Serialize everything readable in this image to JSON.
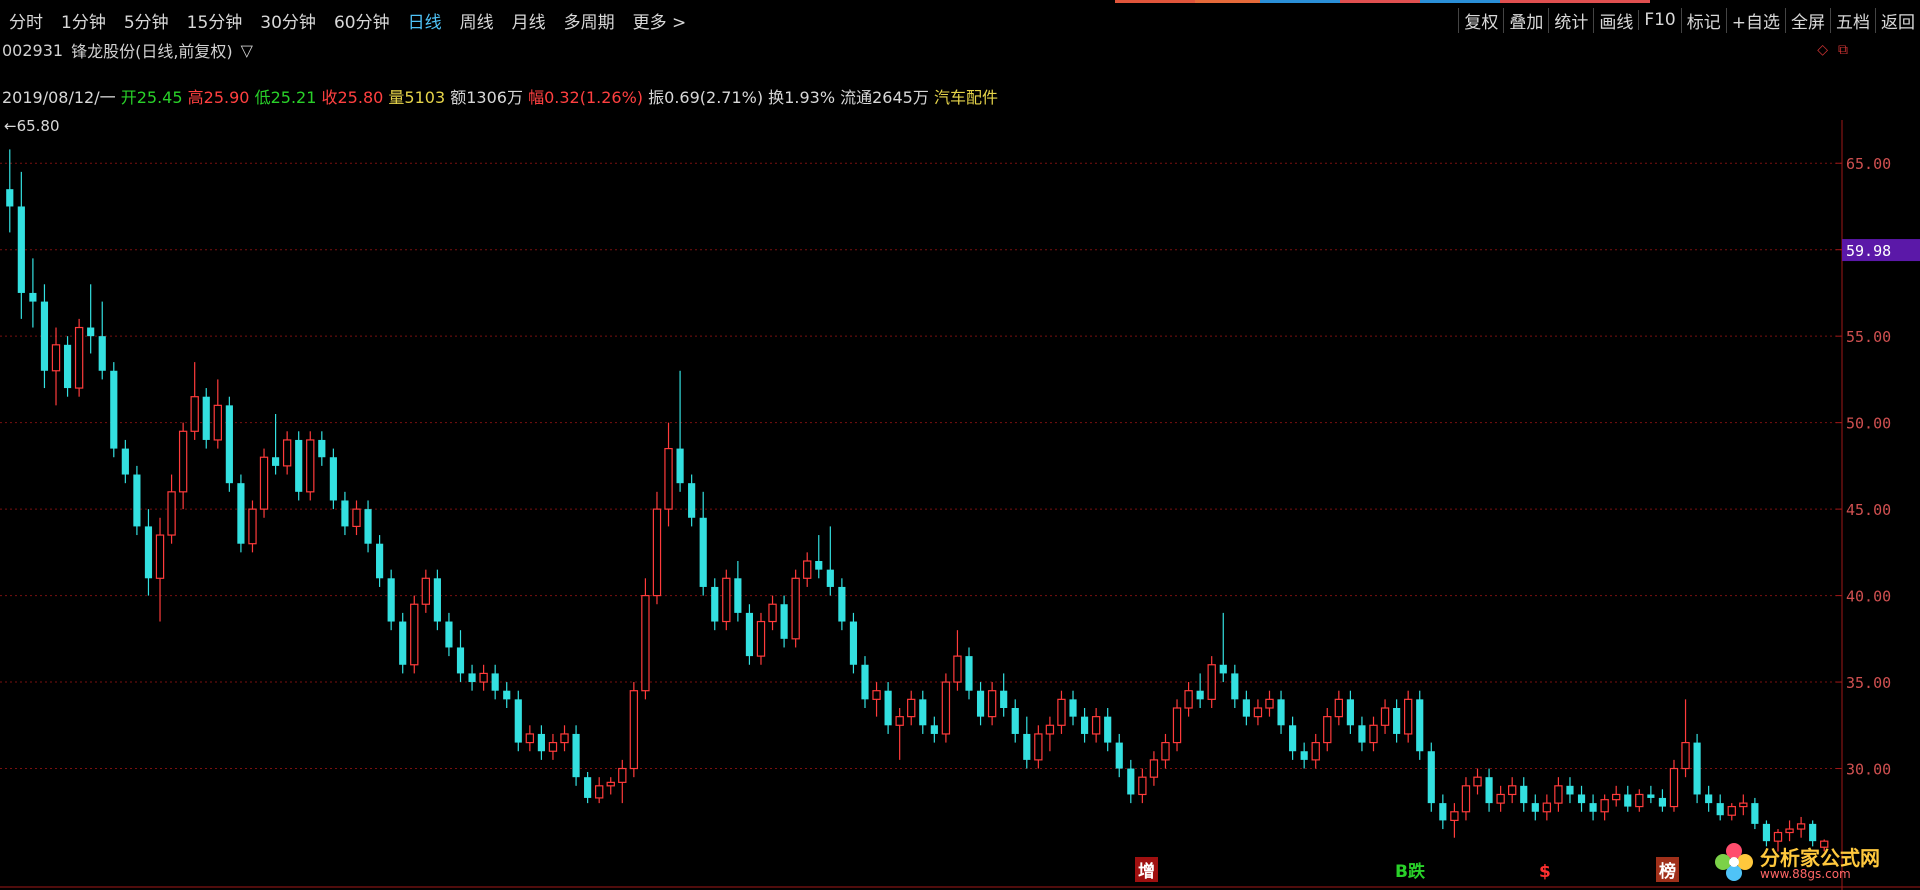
{
  "tabs": [
    {
      "label": "分时",
      "active": false
    },
    {
      "label": "1分钟",
      "active": false
    },
    {
      "label": "5分钟",
      "active": false
    },
    {
      "label": "15分钟",
      "active": false
    },
    {
      "label": "30分钟",
      "active": false
    },
    {
      "label": "60分钟",
      "active": false
    },
    {
      "label": "日线",
      "active": true
    },
    {
      "label": "周线",
      "active": false
    },
    {
      "label": "月线",
      "active": false
    },
    {
      "label": "多周期",
      "active": false
    },
    {
      "label": "更多 >",
      "active": false
    }
  ],
  "toolbar": [
    "复权",
    "叠加",
    "统计",
    "画线",
    "F10",
    "标记",
    "+自选",
    "全屏",
    "五档",
    "返回"
  ],
  "stock": {
    "code": "002931",
    "name": "锋龙股份(日线,前复权)",
    "dropdown": "▽"
  },
  "info": {
    "date": "2019/08/12/一",
    "open_label": "开",
    "open": "25.45",
    "high_label": "高",
    "high": "25.90",
    "low_label": "低",
    "low": "25.21",
    "close_label": "收",
    "close": "25.80",
    "vol_label": "量",
    "vol": "5103",
    "amount_label": "额",
    "amount": "1306万",
    "range_label": "幅",
    "range": "0.32(1.26%)",
    "amp_label": "振",
    "amp": "0.69(2.71%)",
    "turn_label": "换",
    "turn": "1.93%",
    "float_label": "流通",
    "float": "2645万",
    "sector": "汽车配件"
  },
  "max_label": "←65.80",
  "current_price": "59.98",
  "badges": [
    {
      "text": "增",
      "color": "#ffffff",
      "bg": "#a01010"
    },
    {
      "text": "B跌",
      "color": "#29d129",
      "bg": "#000"
    },
    {
      "text": "$",
      "color": "#ff3030",
      "bg": "#000"
    },
    {
      "text": "榜",
      "color": "#ffffff",
      "bg": "#a0301a"
    }
  ],
  "logo": {
    "text": "分析家公式网",
    "url": "www.88gs.com"
  },
  "colors": {
    "up": "#ff3b3b",
    "down": "#33e0e0",
    "grid": "#7a1010",
    "axis": "#a01818",
    "label": "#d05050",
    "price_tag": "#5b18a8"
  },
  "chart_data": {
    "type": "candlestick",
    "ylim": [
      25,
      67.5
    ],
    "y_ticks": [
      "65.00",
      "60.00",
      "55.00",
      "50.00",
      "45.00",
      "40.00",
      "35.00",
      "30.00"
    ],
    "candles": [
      [
        63.5,
        65.8,
        61.0,
        62.5
      ],
      [
        62.5,
        64.5,
        56.0,
        57.5
      ],
      [
        57.5,
        59.5,
        55.5,
        57.0
      ],
      [
        57.0,
        58.0,
        52.0,
        53.0
      ],
      [
        53.0,
        55.5,
        51.0,
        54.5
      ],
      [
        54.5,
        55.0,
        51.5,
        52.0
      ],
      [
        52.0,
        56.0,
        51.5,
        55.5
      ],
      [
        55.5,
        58.0,
        54.0,
        55.0
      ],
      [
        55.0,
        57.0,
        52.5,
        53.0
      ],
      [
        53.0,
        53.5,
        48.0,
        48.5
      ],
      [
        48.5,
        49.0,
        46.5,
        47.0
      ],
      [
        47.0,
        47.5,
        43.5,
        44.0
      ],
      [
        44.0,
        45.0,
        40.0,
        41.0
      ],
      [
        41.0,
        44.5,
        38.5,
        43.5
      ],
      [
        43.5,
        47.0,
        43.0,
        46.0
      ],
      [
        46.0,
        50.0,
        45.0,
        49.5
      ],
      [
        49.5,
        53.5,
        49.0,
        51.5
      ],
      [
        51.5,
        52.0,
        48.5,
        49.0
      ],
      [
        49.0,
        52.5,
        48.5,
        51.0
      ],
      [
        51.0,
        51.5,
        46.0,
        46.5
      ],
      [
        46.5,
        47.0,
        42.5,
        43.0
      ],
      [
        43.0,
        45.5,
        42.5,
        45.0
      ],
      [
        45.0,
        48.5,
        44.5,
        48.0
      ],
      [
        48.0,
        50.5,
        47.0,
        47.5
      ],
      [
        47.5,
        49.5,
        47.0,
        49.0
      ],
      [
        49.0,
        49.5,
        45.5,
        46.0
      ],
      [
        46.0,
        49.5,
        45.5,
        49.0
      ],
      [
        49.0,
        49.5,
        47.5,
        48.0
      ],
      [
        48.0,
        48.5,
        45.0,
        45.5
      ],
      [
        45.5,
        46.0,
        43.5,
        44.0
      ],
      [
        44.0,
        45.5,
        43.5,
        45.0
      ],
      [
        45.0,
        45.5,
        42.5,
        43.0
      ],
      [
        43.0,
        43.5,
        40.5,
        41.0
      ],
      [
        41.0,
        41.5,
        38.0,
        38.5
      ],
      [
        38.5,
        39.0,
        35.5,
        36.0
      ],
      [
        36.0,
        40.0,
        35.5,
        39.5
      ],
      [
        39.5,
        41.5,
        39.0,
        41.0
      ],
      [
        41.0,
        41.5,
        38.0,
        38.5
      ],
      [
        38.5,
        39.0,
        36.5,
        37.0
      ],
      [
        37.0,
        38.0,
        35.0,
        35.5
      ],
      [
        35.5,
        36.0,
        34.5,
        35.0
      ],
      [
        35.0,
        36.0,
        34.5,
        35.5
      ],
      [
        35.5,
        36.0,
        34.0,
        34.5
      ],
      [
        34.5,
        35.0,
        33.5,
        34.0
      ],
      [
        34.0,
        34.5,
        31.0,
        31.5
      ],
      [
        31.5,
        32.5,
        31.0,
        32.0
      ],
      [
        32.0,
        32.5,
        30.5,
        31.0
      ],
      [
        31.0,
        32.0,
        30.5,
        31.5
      ],
      [
        31.5,
        32.5,
        31.0,
        32.0
      ],
      [
        32.0,
        32.5,
        29.0,
        29.5
      ],
      [
        29.5,
        29.8,
        28.0,
        28.3
      ],
      [
        28.3,
        29.5,
        28.0,
        29.0
      ],
      [
        29.0,
        29.5,
        28.5,
        29.2
      ],
      [
        29.2,
        30.5,
        28.0,
        30.0
      ],
      [
        30.0,
        35.0,
        29.5,
        34.5
      ],
      [
        34.5,
        41.0,
        34.0,
        40.0
      ],
      [
        40.0,
        46.0,
        39.5,
        45.0
      ],
      [
        45.0,
        50.0,
        44.0,
        48.5
      ],
      [
        48.5,
        53.0,
        46.0,
        46.5
      ],
      [
        46.5,
        47.0,
        44.0,
        44.5
      ],
      [
        44.5,
        46.0,
        40.0,
        40.5
      ],
      [
        40.5,
        41.0,
        38.0,
        38.5
      ],
      [
        38.5,
        41.5,
        38.0,
        41.0
      ],
      [
        41.0,
        42.0,
        38.5,
        39.0
      ],
      [
        39.0,
        39.5,
        36.0,
        36.5
      ],
      [
        36.5,
        39.0,
        36.0,
        38.5
      ],
      [
        38.5,
        40.0,
        38.0,
        39.5
      ],
      [
        39.5,
        40.0,
        37.0,
        37.5
      ],
      [
        37.5,
        41.5,
        37.0,
        41.0
      ],
      [
        41.0,
        42.5,
        40.5,
        42.0
      ],
      [
        42.0,
        43.5,
        41.0,
        41.5
      ],
      [
        41.5,
        44.0,
        40.0,
        40.5
      ],
      [
        40.5,
        41.0,
        38.0,
        38.5
      ],
      [
        38.5,
        39.0,
        35.5,
        36.0
      ],
      [
        36.0,
        36.5,
        33.5,
        34.0
      ],
      [
        34.0,
        35.0,
        33.0,
        34.5
      ],
      [
        34.5,
        35.0,
        32.0,
        32.5
      ],
      [
        32.5,
        33.5,
        30.5,
        33.0
      ],
      [
        33.0,
        34.5,
        32.5,
        34.0
      ],
      [
        34.0,
        34.5,
        32.0,
        32.5
      ],
      [
        32.5,
        33.0,
        31.5,
        32.0
      ],
      [
        32.0,
        35.5,
        31.5,
        35.0
      ],
      [
        35.0,
        38.0,
        34.5,
        36.5
      ],
      [
        36.5,
        37.0,
        34.0,
        34.5
      ],
      [
        34.5,
        35.0,
        32.5,
        33.0
      ],
      [
        33.0,
        35.0,
        32.5,
        34.5
      ],
      [
        34.5,
        35.5,
        33.0,
        33.5
      ],
      [
        33.5,
        34.0,
        31.5,
        32.0
      ],
      [
        32.0,
        33.0,
        30.0,
        30.5
      ],
      [
        30.5,
        32.5,
        30.0,
        32.0
      ],
      [
        32.0,
        33.0,
        31.0,
        32.5
      ],
      [
        32.5,
        34.5,
        32.0,
        34.0
      ],
      [
        34.0,
        34.5,
        32.5,
        33.0
      ],
      [
        33.0,
        33.5,
        31.5,
        32.0
      ],
      [
        32.0,
        33.5,
        31.5,
        33.0
      ],
      [
        33.0,
        33.5,
        31.0,
        31.5
      ],
      [
        31.5,
        32.0,
        29.5,
        30.0
      ],
      [
        30.0,
        30.5,
        28.0,
        28.5
      ],
      [
        28.5,
        30.0,
        28.0,
        29.5
      ],
      [
        29.5,
        31.0,
        29.0,
        30.5
      ],
      [
        30.5,
        32.0,
        30.0,
        31.5
      ],
      [
        31.5,
        34.0,
        31.0,
        33.5
      ],
      [
        33.5,
        35.0,
        33.0,
        34.5
      ],
      [
        34.5,
        35.5,
        33.5,
        34.0
      ],
      [
        34.0,
        36.5,
        33.5,
        36.0
      ],
      [
        36.0,
        39.0,
        35.0,
        35.5
      ],
      [
        35.5,
        36.0,
        33.5,
        34.0
      ],
      [
        34.0,
        34.5,
        32.5,
        33.0
      ],
      [
        33.0,
        34.0,
        32.5,
        33.5
      ],
      [
        33.5,
        34.5,
        33.0,
        34.0
      ],
      [
        34.0,
        34.5,
        32.0,
        32.5
      ],
      [
        32.5,
        33.0,
        30.5,
        31.0
      ],
      [
        31.0,
        31.5,
        30.0,
        30.5
      ],
      [
        30.5,
        32.0,
        30.0,
        31.5
      ],
      [
        31.5,
        33.5,
        31.0,
        33.0
      ],
      [
        33.0,
        34.5,
        32.5,
        34.0
      ],
      [
        34.0,
        34.5,
        32.0,
        32.5
      ],
      [
        32.5,
        33.0,
        31.0,
        31.5
      ],
      [
        31.5,
        33.0,
        31.0,
        32.5
      ],
      [
        32.5,
        34.0,
        32.0,
        33.5
      ],
      [
        33.5,
        34.0,
        31.5,
        32.0
      ],
      [
        32.0,
        34.5,
        31.5,
        34.0
      ],
      [
        34.0,
        34.5,
        30.5,
        31.0
      ],
      [
        31.0,
        31.5,
        27.5,
        28.0
      ],
      [
        28.0,
        28.5,
        26.5,
        27.0
      ],
      [
        27.0,
        28.0,
        26.0,
        27.5
      ],
      [
        27.5,
        29.5,
        27.0,
        29.0
      ],
      [
        29.0,
        30.0,
        28.5,
        29.5
      ],
      [
        29.5,
        30.0,
        27.5,
        28.0
      ],
      [
        28.0,
        29.0,
        27.5,
        28.5
      ],
      [
        28.5,
        29.5,
        28.0,
        29.0
      ],
      [
        29.0,
        29.5,
        27.5,
        28.0
      ],
      [
        28.0,
        28.5,
        27.0,
        27.5
      ],
      [
        27.5,
        28.5,
        27.0,
        28.0
      ],
      [
        28.0,
        29.5,
        27.5,
        29.0
      ],
      [
        29.0,
        29.5,
        28.0,
        28.5
      ],
      [
        28.5,
        29.0,
        27.5,
        28.0
      ],
      [
        28.0,
        28.5,
        27.0,
        27.5
      ],
      [
        27.5,
        28.5,
        27.0,
        28.2
      ],
      [
        28.2,
        29.0,
        27.8,
        28.5
      ],
      [
        28.5,
        29.0,
        27.5,
        27.8
      ],
      [
        27.8,
        28.8,
        27.5,
        28.5
      ],
      [
        28.5,
        29.0,
        28.0,
        28.3
      ],
      [
        28.3,
        28.8,
        27.5,
        27.8
      ],
      [
        27.8,
        30.5,
        27.5,
        30.0
      ],
      [
        30.0,
        34.0,
        29.5,
        31.5
      ],
      [
        31.5,
        32.0,
        28.0,
        28.5
      ],
      [
        28.5,
        29.0,
        27.5,
        28.0
      ],
      [
        28.0,
        28.5,
        27.0,
        27.3
      ],
      [
        27.3,
        28.0,
        27.0,
        27.8
      ],
      [
        27.8,
        28.5,
        27.3,
        28.0
      ],
      [
        28.0,
        28.3,
        26.5,
        26.8
      ],
      [
        26.8,
        27.0,
        25.5,
        25.8
      ],
      [
        25.8,
        26.5,
        25.2,
        26.3
      ],
      [
        26.3,
        27.0,
        25.8,
        26.5
      ],
      [
        26.5,
        27.2,
        26.0,
        26.8
      ],
      [
        26.8,
        27.0,
        25.5,
        25.8
      ],
      [
        25.45,
        25.9,
        25.21,
        25.8
      ]
    ]
  }
}
